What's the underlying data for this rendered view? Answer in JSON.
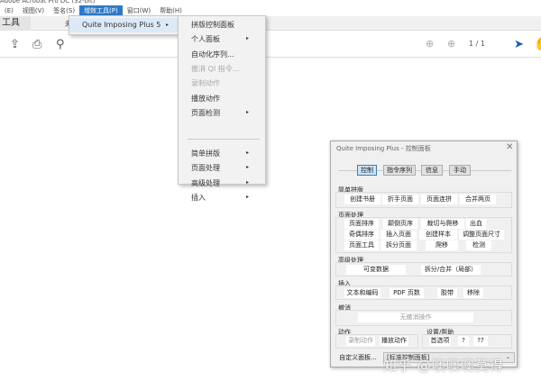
{
  "app": {
    "title": "Adobe Acrobat Pro DC (32-bit)"
  },
  "menubar": [
    "(E)",
    "视图(V)",
    "签名(S)",
    "增效工具(P)",
    "窗口(W)",
    "帮助(H)"
  ],
  "tabs": {
    "tools": "工具",
    "other": "未"
  },
  "toolbar": {
    "page_current": "1",
    "page_total": "/ 1"
  },
  "plugin_menu": {
    "item": "Quite Imposing Plus 5"
  },
  "submenu": [
    {
      "label": "拼版控制面板",
      "arrow": false,
      "disabled": false
    },
    {
      "label": "个人面板",
      "arrow": true,
      "disabled": false
    },
    {
      "label": "自动化序列...",
      "arrow": false,
      "disabled": false
    },
    {
      "label": "撤消 QI 指令...",
      "arrow": false,
      "disabled": true
    },
    {
      "label": "录制动作",
      "arrow": false,
      "disabled": true
    },
    {
      "label": "播放动作",
      "arrow": false,
      "disabled": false
    },
    {
      "label": "页面检测",
      "arrow": true,
      "disabled": false
    },
    {
      "label": "简单拼版",
      "arrow": true,
      "disabled": false
    },
    {
      "label": "页面处理",
      "arrow": true,
      "disabled": false
    },
    {
      "label": "高级处理",
      "arrow": true,
      "disabled": false
    },
    {
      "label": "插入",
      "arrow": true,
      "disabled": false
    }
  ],
  "dialog": {
    "title": "Quite Imposing Plus - 控制面板",
    "close": "✕",
    "tabs": [
      "控制",
      "指令序列",
      "信息",
      "手动"
    ],
    "simple": {
      "label": "简单拼版",
      "buttons": [
        "创建书册",
        "折手页面",
        "页面连拼",
        "合并两页"
      ]
    },
    "page": {
      "label": "页面处理",
      "buttons": [
        "页面排序",
        "颠倒页序",
        "裁切与爬移",
        "出血",
        "奇偶排序",
        "插入页面",
        "创建样本",
        "调整页面尺寸",
        "页面工具",
        "拆分页面",
        "爬移",
        "检测"
      ]
    },
    "advanced": {
      "label": "高级处理",
      "buttons": [
        "可变数据",
        "拆分/合并（局部）"
      ]
    },
    "insert": {
      "label": "插入",
      "buttons": [
        "文本和编码",
        "PDF 页数",
        "胶带",
        "移除"
      ]
    },
    "undo": {
      "label": "撤消",
      "button": "无撤消操作"
    },
    "actions": {
      "label": "动作",
      "buttons": [
        "录制动作",
        "播放动作"
      ]
    },
    "settings": {
      "label": "设置/帮助",
      "buttons": [
        "首选项",
        "?",
        "??"
      ]
    },
    "custom_button": "自定义面板...",
    "panel_select": "[标准控制面板]"
  },
  "watermark": "知乎 @噢噢噢莫得"
}
